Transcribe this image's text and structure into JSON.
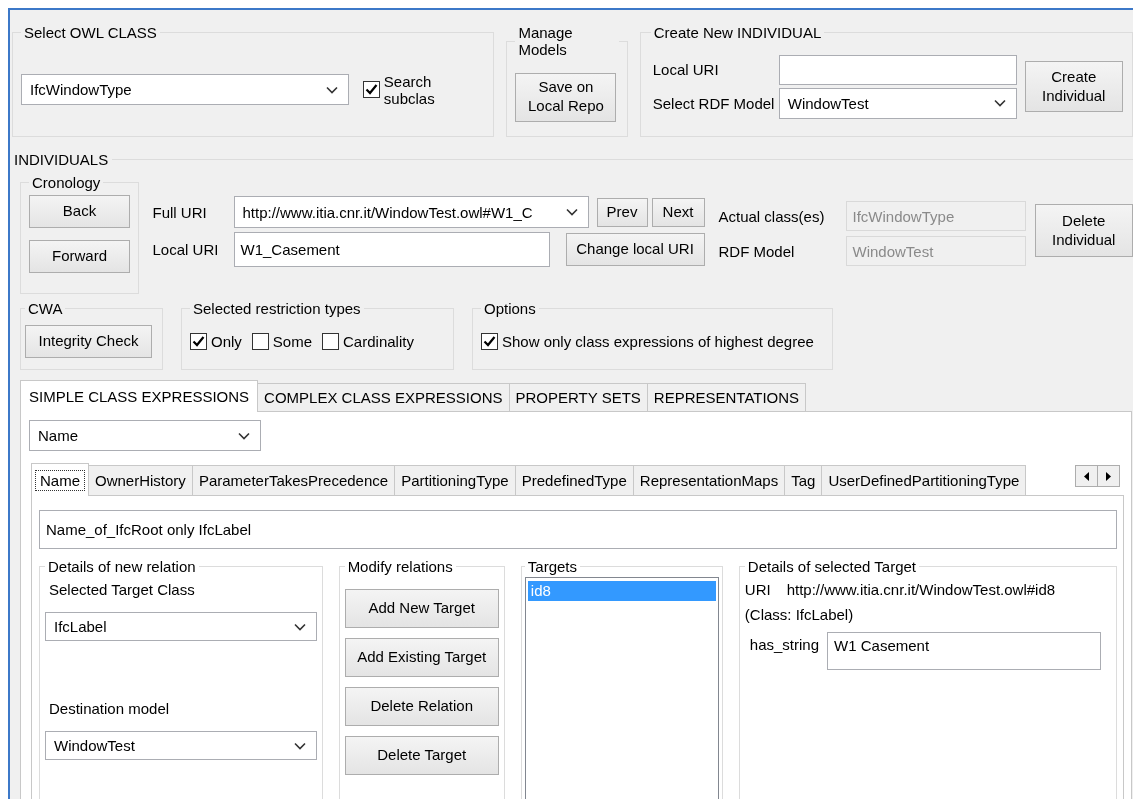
{
  "select_owl_class": {
    "title": "Select OWL CLASS",
    "class_combo": "IfcWindowType",
    "search_subclasses": {
      "label": "Search subclas",
      "checked": true
    }
  },
  "manage_models": {
    "title": "Manage Models",
    "save_button": "Save on Local Repo"
  },
  "create_individual": {
    "title": "Create New INDIVIDUAL",
    "local_uri_label": "Local URI",
    "rdf_model_label": "Select RDF Model",
    "rdf_model": "WindowTest",
    "create_button": "Create Individual"
  },
  "individuals": {
    "title": "INDIVIDUALS",
    "cronology": {
      "title": "Cronology",
      "buttons": [
        "Back",
        "Forward"
      ]
    },
    "full_uri_label": "Full URI",
    "full_uri": "http://www.itia.cnr.it/WindowTest.owl#W1_C",
    "prev_button": "Prev",
    "next_button": "Next",
    "local_uri_label": "Local URI",
    "local_uri": "W1_Casement",
    "change_button": "Change local URI",
    "actual_class_label": "Actual class(es)",
    "actual_class": {
      "value": "IfcWindowType",
      "disabled": true
    },
    "rdf_model_label": "RDF Model",
    "rdf_model": {
      "value": "WindowTest",
      "disabled": true
    },
    "delete_button": "Delete Individual"
  },
  "cwa": {
    "title": "CWA",
    "button": "Integrity Check"
  },
  "restriction_types": {
    "title": "Selected restriction types",
    "options": [
      {
        "label": "Only",
        "checked": true
      },
      {
        "label": "Some",
        "checked": false
      },
      {
        "label": "Cardinality",
        "checked": false
      }
    ]
  },
  "options": {
    "title": "Options",
    "items": [
      {
        "label": "Show only class expressions of highest degree",
        "checked": true
      }
    ]
  },
  "main_tabs": [
    {
      "label": "SIMPLE CLASS EXPRESSIONS",
      "selected": true
    },
    {
      "label": "COMPLEX CLASS EXPRESSIONS",
      "selected": false
    },
    {
      "label": "PROPERTY SETS",
      "selected": false
    },
    {
      "label": "REPRESENTATIONS",
      "selected": false
    }
  ],
  "property_combo": "Name",
  "property_tabs": [
    {
      "label": "Name",
      "selected": true
    },
    {
      "label": "OwnerHistory",
      "selected": false
    },
    {
      "label": "ParameterTakesPrecedence",
      "selected": false
    },
    {
      "label": "PartitioningType",
      "selected": false
    },
    {
      "label": "PredefinedType",
      "selected": false
    },
    {
      "label": "RepresentationMaps",
      "selected": false
    },
    {
      "label": "Tag",
      "selected": false
    },
    {
      "label": "UserDefinedPartitioningType",
      "selected": false
    }
  ],
  "expression": "Name_of_IfcRoot only IfcLabel",
  "new_relation": {
    "title": "Details of new relation",
    "target_class_label": "Selected Target Class",
    "target_class": "IfcLabel",
    "destination_label": "Destination model",
    "destination": "WindowTest"
  },
  "modify_relations": {
    "title": "Modify relations",
    "buttons": [
      "Add New Target",
      "Add Existing Target",
      "Delete Relation",
      "Delete Target"
    ]
  },
  "targets": {
    "title": "Targets",
    "items": [
      {
        "label": "id8",
        "selected": true
      }
    ]
  },
  "target_details": {
    "title": "Details of selected Target",
    "uri_label": "URI",
    "uri": "http://www.itia.cnr.it/WindowTest.owl#id8",
    "class_note": "(Class: IfcLabel)",
    "has_string_label": "has_string",
    "has_string": "W1 Casement"
  }
}
